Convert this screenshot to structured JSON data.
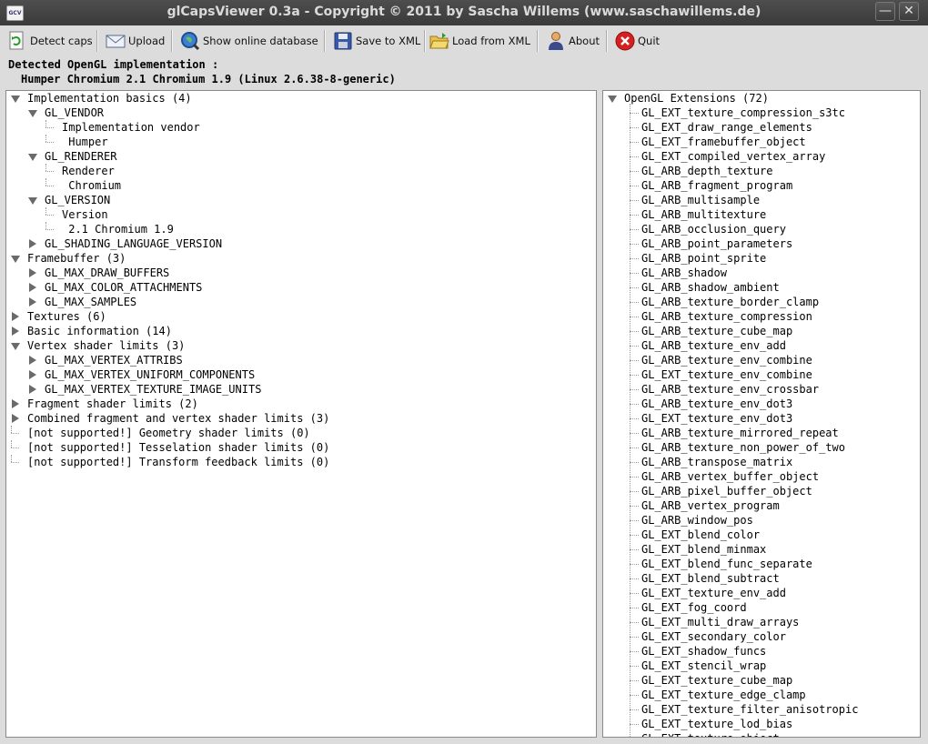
{
  "window": {
    "title": "glCapsViewer 0.3a - Copyright © 2011 by Sascha Willems (www.saschawillems.de)",
    "app_icon_text": "GCV",
    "minimize_glyph": "—",
    "close_glyph": "✕"
  },
  "toolbar": {
    "detect_caps": "Detect caps",
    "upload": "Upload",
    "show_online_database": "Show online database",
    "save_to_xml": "Save to XML",
    "load_from_xml": "Load from XML",
    "about": "About",
    "quit": "Quit"
  },
  "info": {
    "heading": "Detected OpenGL implementation :",
    "implementation": "Humper Chromium 2.1 Chromium 1.9 (Linux 2.6.38-8-generic)"
  },
  "left_tree": [
    {
      "level": 0,
      "state": "expanded",
      "label": "Implementation basics (4)"
    },
    {
      "level": 1,
      "state": "expanded",
      "label": "GL_VENDOR"
    },
    {
      "level": 2,
      "state": "leaf",
      "label": "Implementation vendor"
    },
    {
      "level": 2,
      "state": "leaf",
      "label": " Humper"
    },
    {
      "level": 1,
      "state": "expanded",
      "label": "GL_RENDERER"
    },
    {
      "level": 2,
      "state": "leaf",
      "label": "Renderer"
    },
    {
      "level": 2,
      "state": "leaf",
      "label": " Chromium"
    },
    {
      "level": 1,
      "state": "expanded",
      "label": "GL_VERSION"
    },
    {
      "level": 2,
      "state": "leaf",
      "label": "Version"
    },
    {
      "level": 2,
      "state": "leaf",
      "label": " 2.1 Chromium 1.9"
    },
    {
      "level": 1,
      "state": "collapsed",
      "label": "GL_SHADING_LANGUAGE_VERSION"
    },
    {
      "level": 0,
      "state": "expanded",
      "label": "Framebuffer (3)"
    },
    {
      "level": 1,
      "state": "collapsed",
      "label": "GL_MAX_DRAW_BUFFERS"
    },
    {
      "level": 1,
      "state": "collapsed",
      "label": "GL_MAX_COLOR_ATTACHMENTS"
    },
    {
      "level": 1,
      "state": "collapsed",
      "label": "GL_MAX_SAMPLES"
    },
    {
      "level": 0,
      "state": "collapsed",
      "label": "Textures (6)"
    },
    {
      "level": 0,
      "state": "collapsed",
      "label": "Basic information (14)"
    },
    {
      "level": 0,
      "state": "expanded",
      "label": "Vertex shader limits (3)"
    },
    {
      "level": 1,
      "state": "collapsed",
      "label": "GL_MAX_VERTEX_ATTRIBS"
    },
    {
      "level": 1,
      "state": "collapsed",
      "label": "GL_MAX_VERTEX_UNIFORM_COMPONENTS"
    },
    {
      "level": 1,
      "state": "collapsed",
      "label": "GL_MAX_VERTEX_TEXTURE_IMAGE_UNITS"
    },
    {
      "level": 0,
      "state": "collapsed",
      "label": "Fragment shader limits (2)"
    },
    {
      "level": 0,
      "state": "collapsed",
      "label": "Combined fragment and vertex shader limits (3)"
    },
    {
      "level": 0,
      "state": "leaf",
      "label": "[not supported!] Geometry shader limits (0)"
    },
    {
      "level": 0,
      "state": "leaf",
      "label": "[not supported!] Tesselation shader limits (0)"
    },
    {
      "level": 0,
      "state": "leaf",
      "label": "[not supported!] Transform feedback limits (0)"
    }
  ],
  "extensions": {
    "root_label": "OpenGL Extensions (72)",
    "items": [
      "GL_EXT_texture_compression_s3tc",
      "GL_EXT_draw_range_elements",
      "GL_EXT_framebuffer_object",
      "GL_EXT_compiled_vertex_array",
      "GL_ARB_depth_texture",
      "GL_ARB_fragment_program",
      "GL_ARB_multisample",
      "GL_ARB_multitexture",
      "GL_ARB_occlusion_query",
      "GL_ARB_point_parameters",
      "GL_ARB_point_sprite",
      "GL_ARB_shadow",
      "GL_ARB_shadow_ambient",
      "GL_ARB_texture_border_clamp",
      "GL_ARB_texture_compression",
      "GL_ARB_texture_cube_map",
      "GL_ARB_texture_env_add",
      "GL_ARB_texture_env_combine",
      "GL_EXT_texture_env_combine",
      "GL_ARB_texture_env_crossbar",
      "GL_ARB_texture_env_dot3",
      "GL_EXT_texture_env_dot3",
      "GL_ARB_texture_mirrored_repeat",
      "GL_ARB_texture_non_power_of_two",
      "GL_ARB_transpose_matrix",
      "GL_ARB_vertex_buffer_object",
      "GL_ARB_pixel_buffer_object",
      "GL_ARB_vertex_program",
      "GL_ARB_window_pos",
      "GL_EXT_blend_color",
      "GL_EXT_blend_minmax",
      "GL_EXT_blend_func_separate",
      "GL_EXT_blend_subtract",
      "GL_EXT_texture_env_add",
      "GL_EXT_fog_coord",
      "GL_EXT_multi_draw_arrays",
      "GL_EXT_secondary_color",
      "GL_EXT_shadow_funcs",
      "GL_EXT_stencil_wrap",
      "GL_EXT_texture_cube_map",
      "GL_EXT_texture_edge_clamp",
      "GL_EXT_texture_filter_anisotropic",
      "GL_EXT_texture_lod_bias",
      "GL_EXT_texture_object"
    ]
  },
  "icons": {
    "detect_caps": "refresh-document-icon",
    "upload": "envelope-icon",
    "show_online_database": "globe-magnifier-icon",
    "save_to_xml": "floppy-disk-icon",
    "load_from_xml": "folder-open-icon",
    "about": "person-icon",
    "quit": "red-close-circle-icon"
  },
  "colors": {
    "titlebar": "#3a3a3a",
    "window_bg": "#dcdcdc",
    "panel_bg": "#ffffff",
    "quit_red": "#d42020"
  }
}
